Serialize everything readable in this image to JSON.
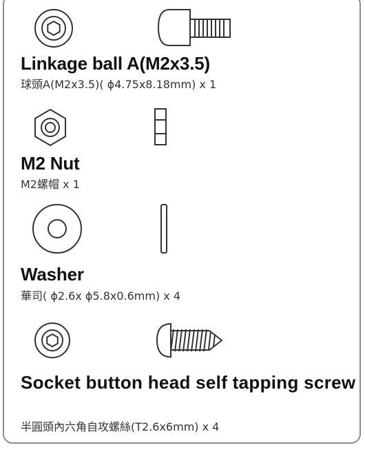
{
  "parts": [
    {
      "name": "Linkage ball A(M2x3.5)",
      "spec": "球頭A(M2x3.5)( ϕ4.75x8.18mm) x 1",
      "icons": [
        "socket-head-icon",
        "linkage-ball-side-icon"
      ]
    },
    {
      "name": "M2 Nut",
      "spec": "M2螺帽 x 1",
      "icons": [
        "hex-nut-icon",
        "nut-side-icon"
      ]
    },
    {
      "name": "Washer",
      "spec": "華司( ϕ2.6x ϕ5.8x0.6mm) x 4",
      "icons": [
        "washer-icon",
        "washer-side-icon"
      ]
    },
    {
      "name": "Socket button head self tapping screw",
      "spec": "半圓頭內六角自攻螺絲(T2.6x6mm) x 4",
      "icons": [
        "button-head-socket-icon",
        "tapping-screw-side-icon"
      ]
    }
  ]
}
